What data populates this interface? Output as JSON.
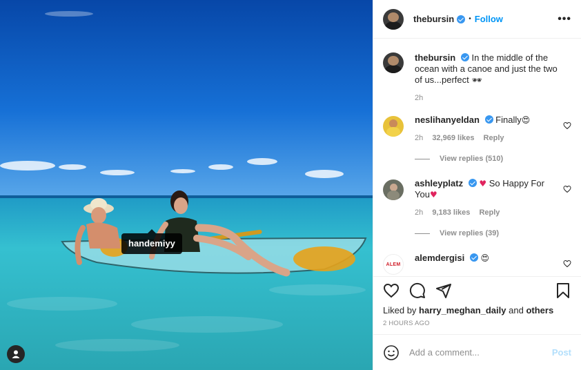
{
  "post": {
    "author": "thebursin",
    "follow_label": "Follow",
    "dot": "•",
    "more_label": "•••",
    "photo_tag": "handemiyy",
    "caption_text": "In the middle of the ocean with a canoe and just the two of us...perfect",
    "caption_emoji": "🕶",
    "caption_time": "2h"
  },
  "comments": [
    {
      "user": "neslihanyeldan",
      "text": "Finally",
      "emoji": "😍",
      "time": "2h",
      "likes": "32,969 likes",
      "reply_label": "Reply",
      "view_replies": "View replies (510)"
    },
    {
      "user": "ashleyplatz",
      "emoji_before": "♥",
      "text": "So Happy For You",
      "emoji": "♥",
      "time": "2h",
      "likes": "9,183 likes",
      "reply_label": "Reply",
      "view_replies": "View replies (39)"
    },
    {
      "user": "alemdergisi",
      "text": "",
      "emoji": "😍",
      "avatar_text": "ALEM"
    }
  ],
  "likes_prefix": "Liked by",
  "likes_user": "harry_meghan_daily",
  "likes_and": "and",
  "likes_others": "others",
  "timestamp": "2 HOURS AGO",
  "add_comment": {
    "placeholder": "Add a comment...",
    "post_label": "Post"
  },
  "icons": {
    "like": "heart-icon",
    "comment": "comment-icon",
    "share": "share-icon",
    "save": "bookmark-icon",
    "emoji": "emoji-icon",
    "tags": "user-tag-icon"
  },
  "colors": {
    "link": "#0095f6",
    "verified": "#3897f0",
    "post_disabled": "#b2dffc",
    "muted": "#8e8e8e"
  }
}
